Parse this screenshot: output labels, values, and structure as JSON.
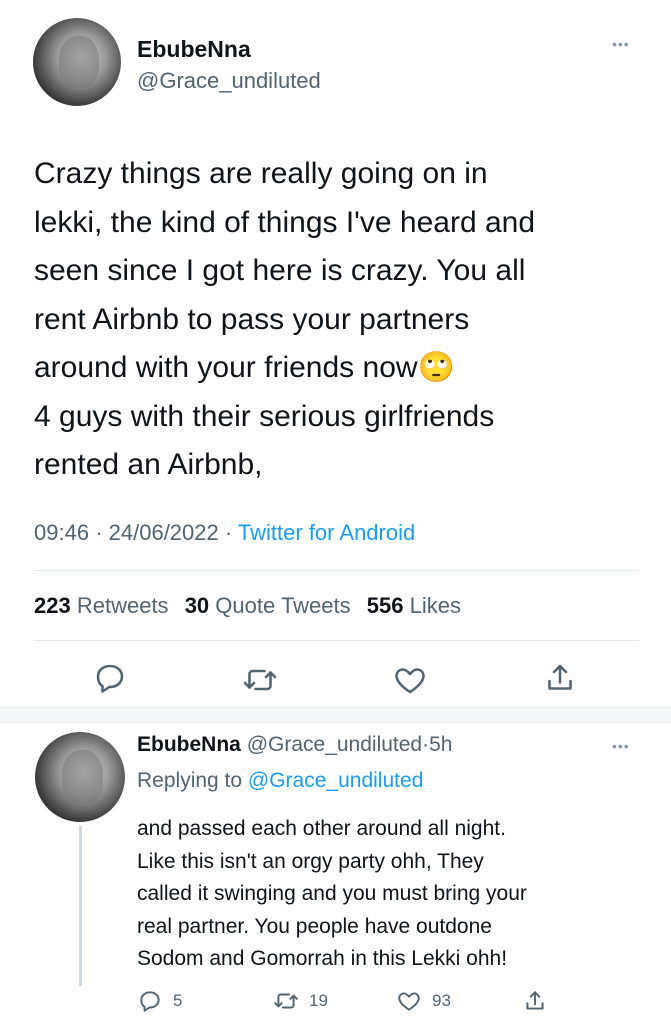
{
  "main_tweet": {
    "display_name": "EbubeNna",
    "handle": "@Grace_undiluted",
    "text": "Crazy things are really going on in\nlekki, the kind of things I've heard and\nseen since I got here is crazy. You all\nrent Airbnb to pass your partners\naround with your friends now🙄\n4 guys with their serious girlfriends\nrented an Airbnb,",
    "time": "09:46",
    "date": "24/06/2022",
    "dot": "·",
    "source": "Twitter for Android",
    "stats": {
      "retweets_count": "223",
      "retweets_label": "Retweets",
      "quotes_count": "30",
      "quotes_label": "Quote Tweets",
      "likes_count": "556",
      "likes_label": "Likes"
    },
    "icons": [
      "reply-icon",
      "retweet-icon",
      "like-icon",
      "share-icon"
    ]
  },
  "reply_tweet": {
    "display_name": "EbubeNna",
    "handle": "@Grace_undiluted",
    "dot": "·",
    "age": "5h",
    "replying_prefix": "Replying to",
    "replying_to": "@Grace_undiluted",
    "text": "and passed each other around all night.\nLike this isn't an orgy party ohh, They\ncalled it swinging and you must bring your\nreal partner. You people have outdone\nSodom and Gomorrah in this Lekki ohh!",
    "replies": "5",
    "retweets": "19",
    "likes": "93"
  },
  "colors": {
    "text": "#0f1419",
    "muted": "#536471",
    "link": "#1d9bf0",
    "icon": "#536471"
  }
}
